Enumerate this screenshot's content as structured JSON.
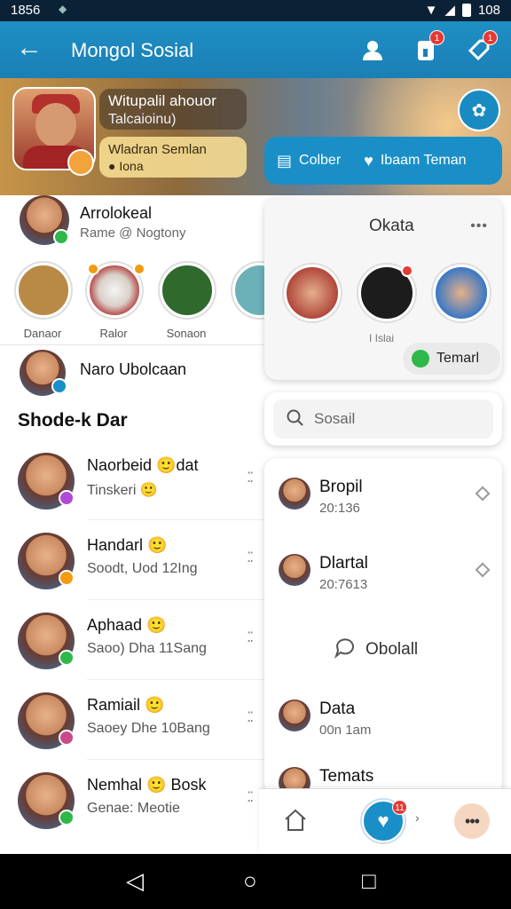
{
  "status_bar": {
    "time": "1856",
    "battery": "108"
  },
  "app_bar": {
    "title": "Mongol Sosial",
    "back_icon": "arrow-left-icon",
    "profile_icon": "person-icon",
    "notif_badge": "1",
    "share_badge": "1"
  },
  "banner": {
    "caption_line1": "Witupalil ahouor",
    "caption_line2": "Talcaioinu)",
    "caption2_line1": "Wladran Semlan",
    "caption2_line2": "Iona",
    "btn_left": "Colber",
    "btn_right": "Ibaam Teman"
  },
  "left": {
    "profile_name": "Arrolokeal",
    "profile_sub": "Rame @ Nogtony",
    "stories": [
      {
        "label": "Danaor"
      },
      {
        "label": "Ralor"
      },
      {
        "label": "Sonaon"
      }
    ],
    "pinned_name": "Naro Ubolcaan",
    "section_title": "Shode-k Dar",
    "chats": [
      {
        "name": "Naorbeid 🙂dat",
        "sub": "Tinskeri 🙂"
      },
      {
        "name": "Handarl 🙂",
        "sub": "Soodt, Uod 12Ing"
      },
      {
        "name": "Aphaad 🙂",
        "sub": "Saoo) Dha 11Sang"
      },
      {
        "name": "Ramiail 🙂",
        "sub": "Saoey Dhe 10Bang"
      },
      {
        "name": "Nemhal 🙂 Bosk",
        "sub": "Genae: Meotie"
      }
    ]
  },
  "right": {
    "stories_title": "Okata",
    "stories_label": "I Islai",
    "teman_label": "Temarl",
    "search_placeholder": "Sosail",
    "list": [
      {
        "name": "Bropil",
        "sub": "20:136"
      },
      {
        "name": "Dlartal",
        "sub": "20:7613"
      }
    ],
    "call_label": "Obolall",
    "list2": [
      {
        "name": "Data",
        "sub": "00n 1am"
      },
      {
        "name": "Temats",
        "sub": ""
      }
    ]
  },
  "bottom_nav": {
    "heart_badge": "11"
  },
  "colors": {
    "primary": "#1a8fc7",
    "accent": "#e53935"
  }
}
